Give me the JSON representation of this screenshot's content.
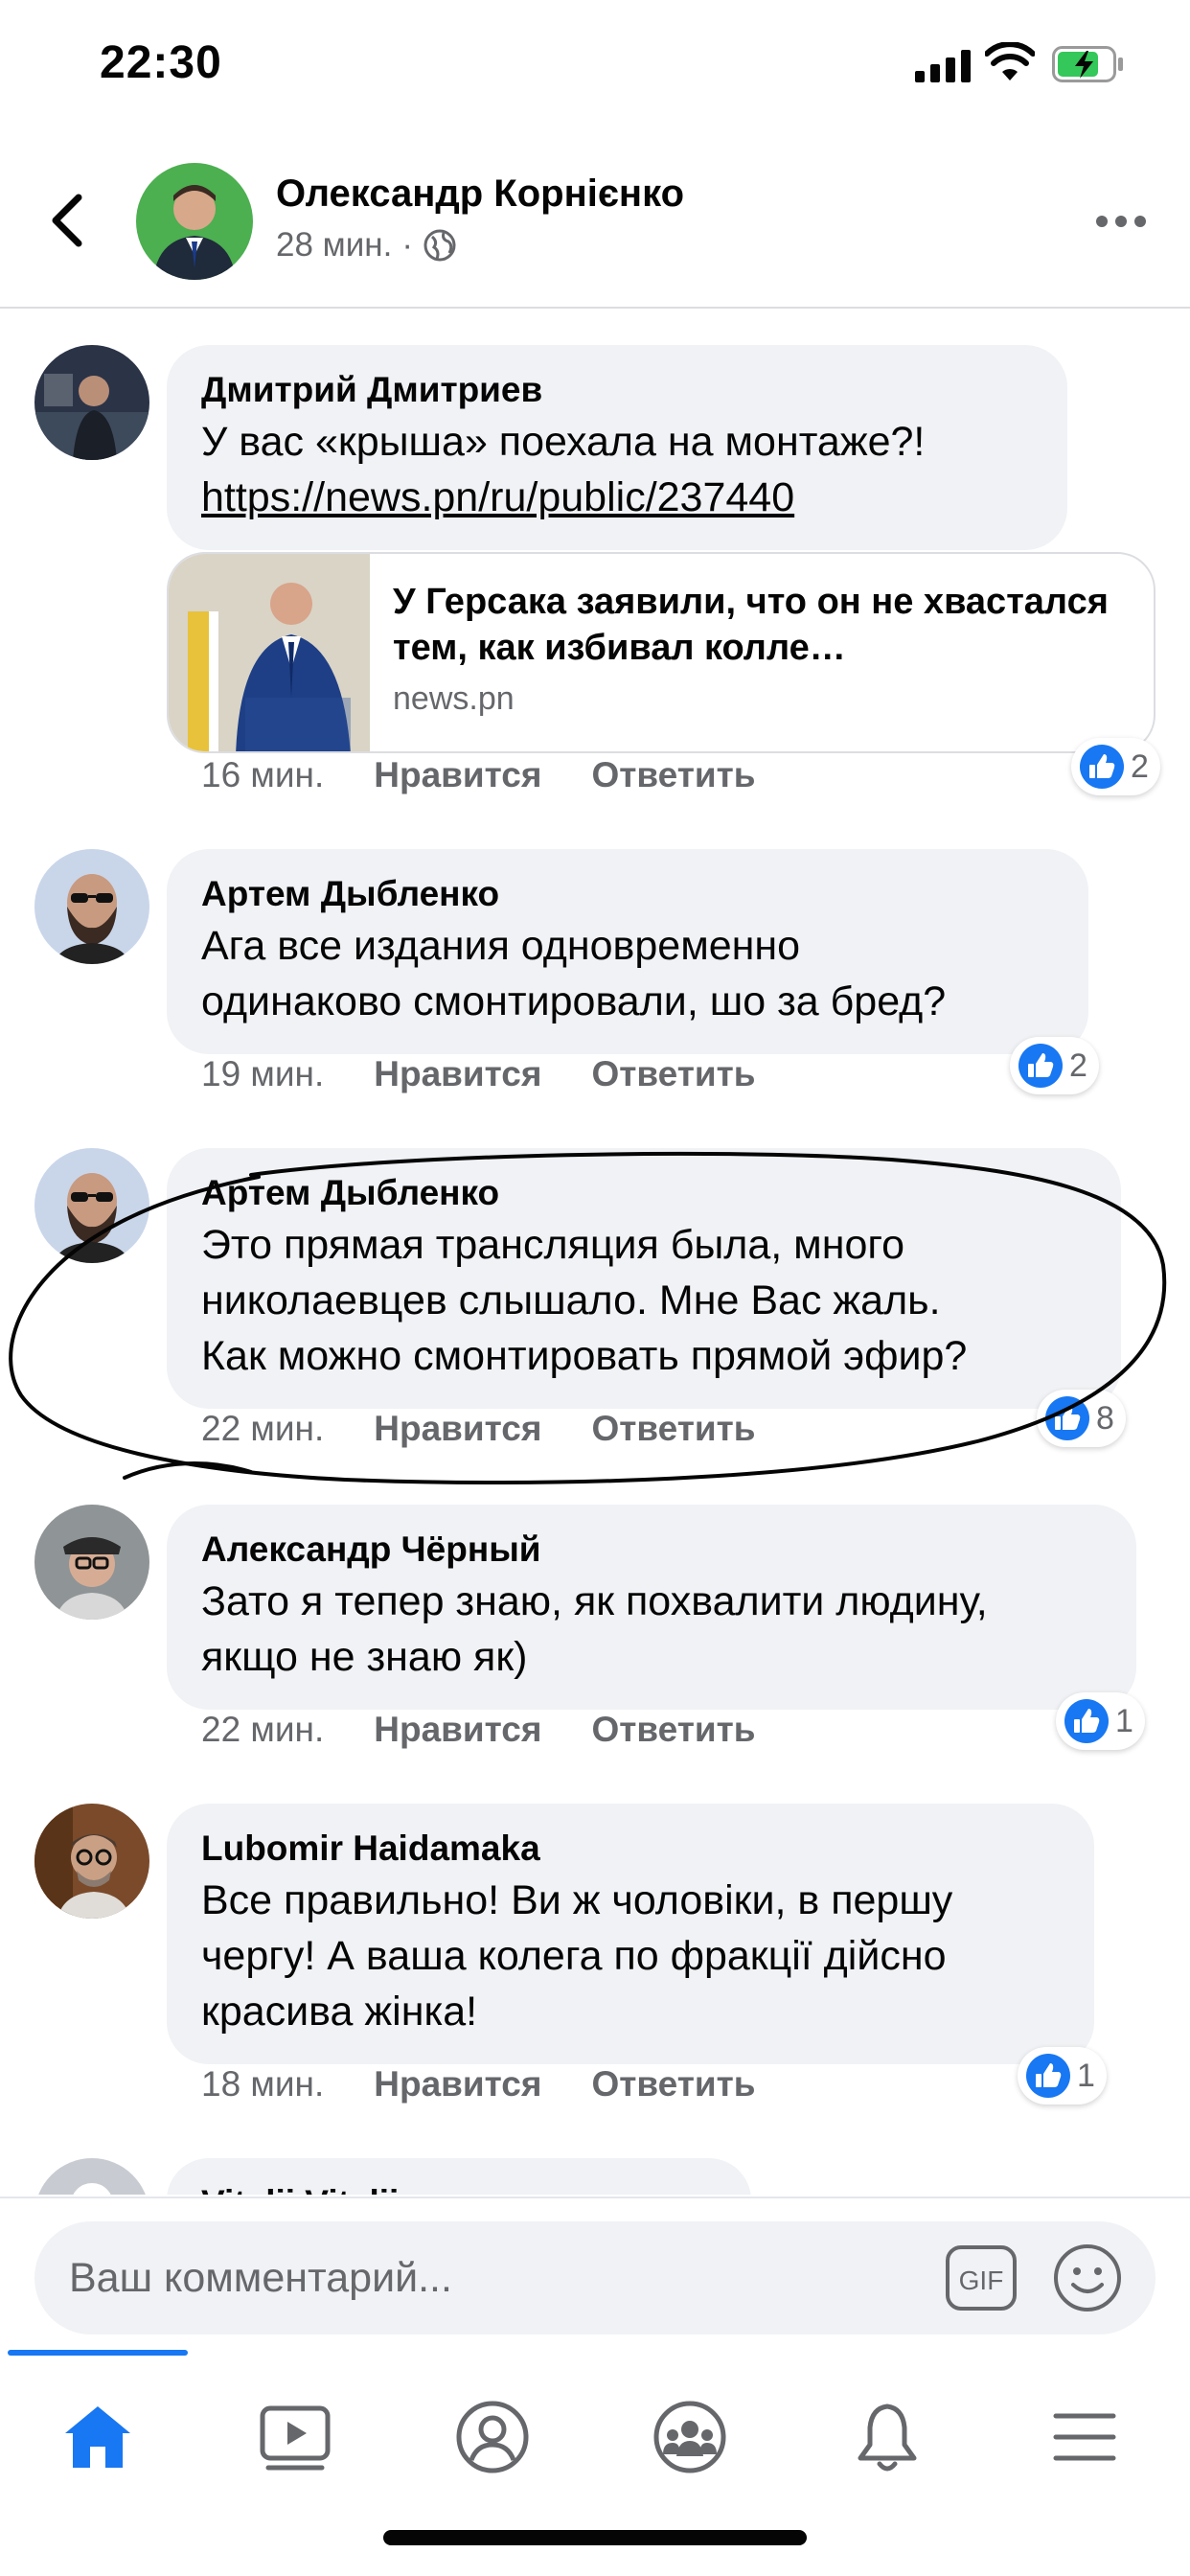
{
  "status_bar": {
    "time": "22:30"
  },
  "header": {
    "name": "Олександр Корнієнко",
    "time": "28 мин.",
    "separator": "·"
  },
  "comments": [
    {
      "author": "Дмитрий Дмитриев",
      "text": "У вас «крыша» поехала на монтаже?!",
      "link": "https://news.pn/ru/public/237440",
      "preview": {
        "title": "У Герсака заявили, что он не хвастался тем, как избивал колле…",
        "domain": "news.pn"
      },
      "time": "16 мин.",
      "like_label": "Нравится",
      "reply_label": "Ответить",
      "reaction_count": "2"
    },
    {
      "author": "Артем Дыбленко",
      "text": "Ага все издания одновременно\nодинаково смонтировали, шо за бред?",
      "time": "19 мин.",
      "like_label": "Нравится",
      "reply_label": "Ответить",
      "reaction_count": "2"
    },
    {
      "author": "Артем Дыбленко",
      "text": "Это прямая трансляция была, много\nниколаевцев слышало. Мне Вас жаль.\nКак можно смонтировать прямой эфир?",
      "time": "22 мин.",
      "like_label": "Нравится",
      "reply_label": "Ответить",
      "reaction_count": "8"
    },
    {
      "author": "Александр Чёрный",
      "text": "Зато я тепер знаю, як похвалити людину,\nякщо не знаю як)",
      "time": "22 мин.",
      "like_label": "Нравится",
      "reply_label": "Ответить",
      "reaction_count": "1"
    },
    {
      "author": "Lubomir Haidamaka",
      "text": "Все правильно! Ви ж чоловіки, в першу\nчергу! А ваша колега по фракції дійсно\nкрасива жінка!",
      "time": "18 мин.",
      "like_label": "Нравится",
      "reply_label": "Ответить",
      "reaction_count": "1"
    },
    {
      "author": "Vitalii Vitalii"
    }
  ],
  "composer": {
    "placeholder": "Ваш комментарий...",
    "gif_label": "GIF"
  },
  "tabs": [
    "home-icon",
    "watch-icon",
    "profile-icon",
    "groups-icon",
    "notifications-icon",
    "menu-icon"
  ],
  "colors": {
    "accent": "#1877f2",
    "bubble": "#f0f2f5",
    "secondary_text": "#65676b"
  }
}
